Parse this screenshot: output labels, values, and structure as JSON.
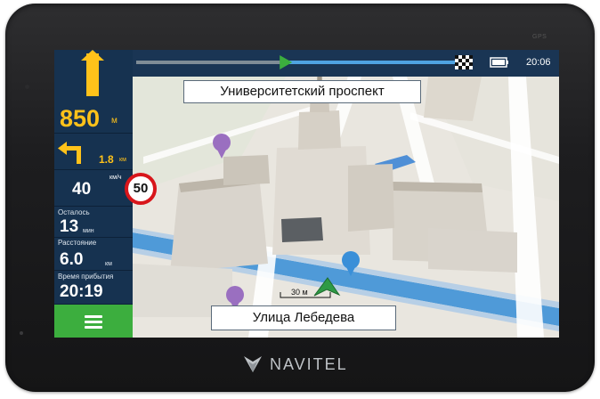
{
  "device": {
    "gps_label": "GPS",
    "brand": "NAVITEL"
  },
  "top_bar": {
    "clock": "20:06",
    "route_progress": 0.47
  },
  "maneuver": {
    "distance": "850",
    "distance_unit": "м",
    "next_distance": "1.8",
    "next_distance_unit": "км"
  },
  "speed": {
    "current": "40",
    "unit": "км/ч",
    "limit": "50"
  },
  "trip": {
    "remaining_label": "Осталось",
    "remaining_time": "13",
    "remaining_unit": "мин",
    "distance_label": "Расстояние",
    "distance_value": "6.0",
    "distance_unit": "км",
    "arrival_label": "Время прибытия",
    "arrival_time": "20:19"
  },
  "map": {
    "current_street": "Университетский проспект",
    "next_street": "Улица Лебедева",
    "scale": "30 м"
  },
  "colors": {
    "panel": "#1e3a5a",
    "accent_yellow": "#ffc21a",
    "menu_green": "#3cae3e",
    "route_blue": "#4f9ad8"
  }
}
